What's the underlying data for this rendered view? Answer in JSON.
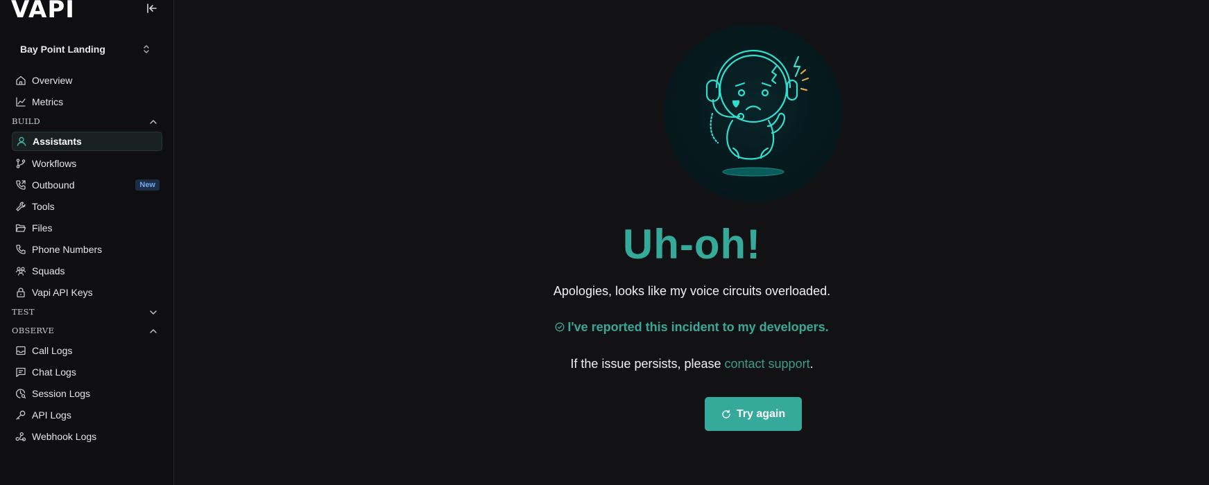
{
  "app": {
    "logo": "VAPI"
  },
  "org": {
    "name": "Bay Point Landing"
  },
  "nav": {
    "overview": "Overview",
    "metrics": "Metrics",
    "build_header": "BUILD",
    "assistants": "Assistants",
    "workflows": "Workflows",
    "outbound": "Outbound",
    "outbound_badge": "New",
    "tools": "Tools",
    "files": "Files",
    "phone_numbers": "Phone Numbers",
    "squads": "Squads",
    "api_keys": "Vapi API Keys",
    "test_header": "TEST",
    "observe_header": "OBSERVE",
    "call_logs": "Call Logs",
    "chat_logs": "Chat Logs",
    "session_logs": "Session Logs",
    "api_logs": "API Logs",
    "webhook_logs": "Webhook Logs"
  },
  "error": {
    "title": "Uh-oh!",
    "message": "Apologies, looks like my voice circuits overloaded.",
    "reported": "I've reported this incident to my developers.",
    "persist_prefix": "If the issue persists, please ",
    "contact_link": "contact support",
    "persist_suffix": ".",
    "retry_label": "Try again"
  },
  "colors": {
    "accent": "#35a99a",
    "background": "#121214",
    "sidebar": "#0f0f11",
    "badge_bg": "#1c2d46",
    "badge_text": "#74a7ec"
  },
  "icons": {
    "collapse": "collapse-sidebar-icon",
    "org_chevron": "chevron-up-down-icon",
    "overview": "home-icon",
    "metrics": "chart-line-icon",
    "assistants": "user-icon",
    "workflows": "git-branch-icon",
    "outbound": "phone-outgoing-icon",
    "tools": "wrench-icon",
    "files": "folder-open-icon",
    "phone_numbers": "phone-icon",
    "squads": "users-icon",
    "api_keys": "lock-icon",
    "call_logs": "inbox-icon",
    "chat_logs": "message-square-icon",
    "session_logs": "clock-search-icon",
    "api_logs": "key-icon",
    "webhook_logs": "webhook-icon",
    "reported": "check-circle-icon",
    "retry": "refresh-icon"
  }
}
